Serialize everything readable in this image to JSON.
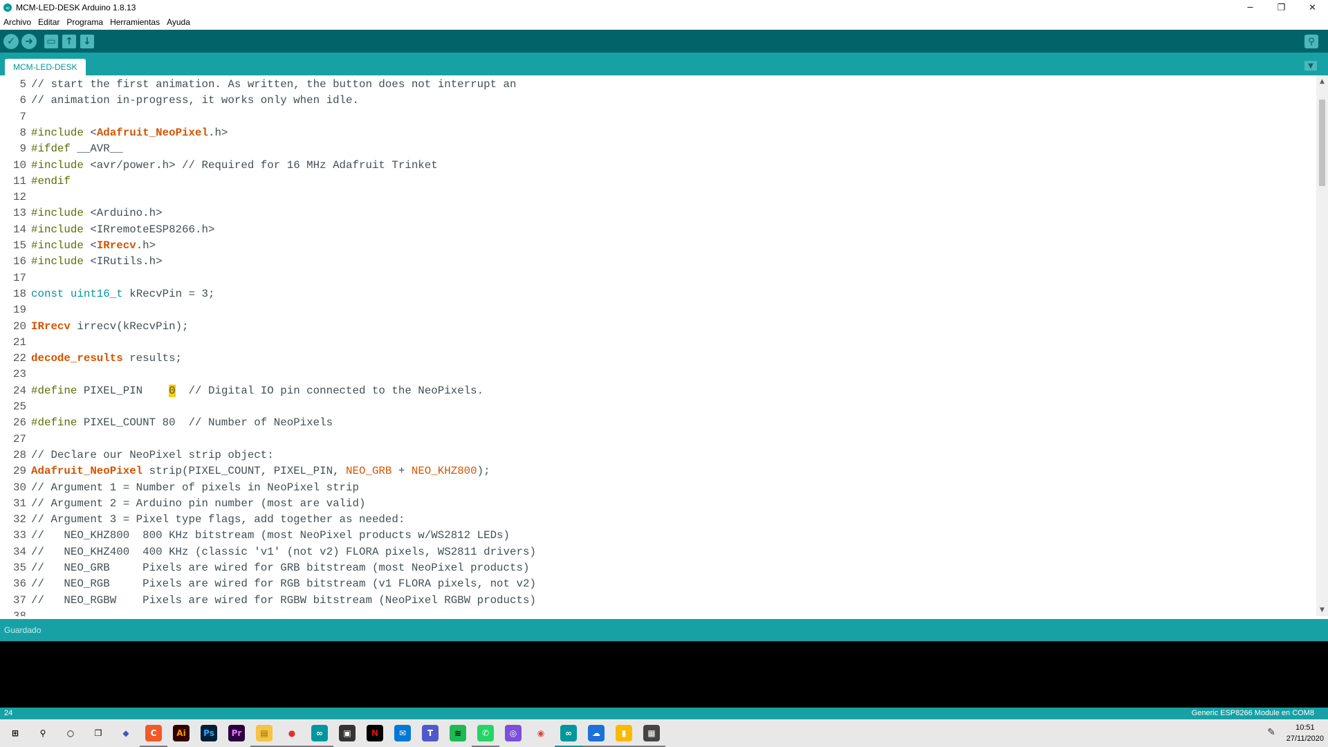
{
  "window": {
    "title": "MCM-LED-DESK Arduino 1.8.13",
    "minimize": "─",
    "restore": "❐",
    "close": "✕"
  },
  "menu": [
    "Archivo",
    "Editar",
    "Programa",
    "Herramientas",
    "Ayuda"
  ],
  "toolbar": {
    "verify_icon": "✓",
    "upload_icon": "➜",
    "new_icon": "▭",
    "open_icon": "↑",
    "save_icon": "↓",
    "serial_icon": "⚲"
  },
  "tabs": [
    {
      "label": "MCM-LED-DESK"
    }
  ],
  "tab_menu_icon": "▼",
  "code_lines": [
    {
      "n": "5",
      "parts": [
        [
          "cmt",
          "// start the first animation. As written, the button does not interrupt an"
        ]
      ]
    },
    {
      "n": "6",
      "parts": [
        [
          "cmt",
          "// animation in-progress, it works only when idle."
        ]
      ]
    },
    {
      "n": "7",
      "parts": []
    },
    {
      "n": "8",
      "parts": [
        [
          "kw",
          "#include"
        ],
        [
          "",
          " <"
        ],
        [
          "cls",
          "Adafruit_NeoPixel"
        ],
        [
          "",
          ".h>"
        ]
      ]
    },
    {
      "n": "9",
      "parts": [
        [
          "kw",
          "#ifdef"
        ],
        [
          "",
          " __AVR__"
        ]
      ]
    },
    {
      "n": "10",
      "parts": [
        [
          "kw",
          "#include"
        ],
        [
          "",
          " <avr/power.h> // Required for 16 MHz Adafruit Trinket"
        ]
      ]
    },
    {
      "n": "11",
      "parts": [
        [
          "kw",
          "#endif"
        ]
      ]
    },
    {
      "n": "12",
      "parts": []
    },
    {
      "n": "13",
      "parts": [
        [
          "kw",
          "#include"
        ],
        [
          "",
          " <Arduino.h>"
        ]
      ]
    },
    {
      "n": "14",
      "parts": [
        [
          "kw",
          "#include"
        ],
        [
          "",
          " <IRremoteESP8266.h>"
        ]
      ]
    },
    {
      "n": "15",
      "parts": [
        [
          "kw",
          "#include"
        ],
        [
          "",
          " <"
        ],
        [
          "cls",
          "IRrecv"
        ],
        [
          "",
          ".h>"
        ]
      ]
    },
    {
      "n": "16",
      "parts": [
        [
          "kw",
          "#include"
        ],
        [
          "",
          " <IRutils.h>"
        ]
      ]
    },
    {
      "n": "17",
      "parts": []
    },
    {
      "n": "18",
      "parts": [
        [
          "type",
          "const"
        ],
        [
          "",
          " "
        ],
        [
          "type",
          "uint16_t"
        ],
        [
          "",
          " kRecvPin = 3;"
        ]
      ]
    },
    {
      "n": "19",
      "parts": []
    },
    {
      "n": "20",
      "parts": [
        [
          "cls",
          "IRrecv"
        ],
        [
          "",
          " irrecv(kRecvPin);"
        ]
      ]
    },
    {
      "n": "21",
      "parts": []
    },
    {
      "n": "22",
      "parts": [
        [
          "cls",
          "decode_results"
        ],
        [
          "",
          " results;"
        ]
      ]
    },
    {
      "n": "23",
      "parts": []
    },
    {
      "n": "24",
      "parts": [
        [
          "kw",
          "#define"
        ],
        [
          "",
          " PIXEL_PIN    "
        ],
        [
          "hl",
          "0"
        ],
        [
          "",
          "  // Digital IO pin connected to the NeoPixels."
        ]
      ]
    },
    {
      "n": "25",
      "parts": []
    },
    {
      "n": "26",
      "parts": [
        [
          "kw",
          "#define"
        ],
        [
          "",
          " PIXEL_COUNT 80  // Number of NeoPixels"
        ]
      ]
    },
    {
      "n": "27",
      "parts": []
    },
    {
      "n": "28",
      "parts": [
        [
          "cmt",
          "// Declare our NeoPixel strip object:"
        ]
      ]
    },
    {
      "n": "29",
      "parts": [
        [
          "cls",
          "Adafruit_NeoPixel"
        ],
        [
          "",
          " strip(PIXEL_COUNT, PIXEL_PIN, "
        ],
        [
          "const",
          "NEO_GRB"
        ],
        [
          "",
          " + "
        ],
        [
          "const",
          "NEO_KHZ800"
        ],
        [
          "",
          ");"
        ]
      ]
    },
    {
      "n": "30",
      "parts": [
        [
          "cmt",
          "// Argument 1 = Number of pixels in NeoPixel strip"
        ]
      ]
    },
    {
      "n": "31",
      "parts": [
        [
          "cmt",
          "// Argument 2 = Arduino pin number (most are valid)"
        ]
      ]
    },
    {
      "n": "32",
      "parts": [
        [
          "cmt",
          "// Argument 3 = Pixel type flags, add together as needed:"
        ]
      ]
    },
    {
      "n": "33",
      "parts": [
        [
          "cmt",
          "//   NEO_KHZ800  800 KHz bitstream (most NeoPixel products w/WS2812 LEDs)"
        ]
      ]
    },
    {
      "n": "34",
      "parts": [
        [
          "cmt",
          "//   NEO_KHZ400  400 KHz (classic 'v1' (not v2) FLORA pixels, WS2811 drivers)"
        ]
      ]
    },
    {
      "n": "35",
      "parts": [
        [
          "cmt",
          "//   NEO_GRB     Pixels are wired for GRB bitstream (most NeoPixel products)"
        ]
      ]
    },
    {
      "n": "36",
      "parts": [
        [
          "cmt",
          "//   NEO_RGB     Pixels are wired for RGB bitstream (v1 FLORA pixels, not v2)"
        ]
      ]
    },
    {
      "n": "37",
      "parts": [
        [
          "cmt",
          "//   NEO_RGBW    Pixels are wired for RGBW bitstream (NeoPixel RGBW products)"
        ]
      ]
    },
    {
      "n": "38",
      "parts": []
    }
  ],
  "status": {
    "message": "Guardado"
  },
  "bottom": {
    "line": "24",
    "board": "Generic ESP8266 Module en COM8"
  },
  "taskbar": {
    "apps": [
      {
        "name": "start-icon",
        "glyph": "⊞",
        "color": "#e8e8e8",
        "fg": "#000"
      },
      {
        "name": "search-icon",
        "glyph": "⚲",
        "color": "#e8e8e8",
        "fg": "#000"
      },
      {
        "name": "cortana-icon",
        "glyph": "○",
        "color": "#e8e8e8",
        "fg": "#000"
      },
      {
        "name": "task-view-icon",
        "glyph": "❐",
        "color": "#e8e8e8",
        "fg": "#000"
      },
      {
        "name": "app-blue-icon",
        "glyph": "◆",
        "color": "#e8e8e8",
        "fg": "#3b5bb5"
      },
      {
        "name": "app-red-icon",
        "glyph": "C",
        "color": "#f05a28",
        "fg": "#fff"
      },
      {
        "name": "illustrator-icon",
        "glyph": "Ai",
        "color": "#330000",
        "fg": "#ff9a00"
      },
      {
        "name": "photoshop-icon",
        "glyph": "Ps",
        "color": "#001e36",
        "fg": "#31a8ff"
      },
      {
        "name": "premiere-icon",
        "glyph": "Pr",
        "color": "#2a003f",
        "fg": "#ea77ff"
      },
      {
        "name": "file-explorer-icon",
        "glyph": "▤",
        "color": "#f6c344",
        "fg": "#8a6d00"
      },
      {
        "name": "app-cube-icon",
        "glyph": "●",
        "color": "#e8e8e8",
        "fg": "#d33"
      },
      {
        "name": "arduino-icon",
        "glyph": "∞",
        "color": "#00979c",
        "fg": "#fff"
      },
      {
        "name": "store-icon",
        "glyph": "▣",
        "color": "#333",
        "fg": "#fff"
      },
      {
        "name": "netflix-icon",
        "glyph": "N",
        "color": "#000",
        "fg": "#e50914"
      },
      {
        "name": "mail-icon",
        "glyph": "✉",
        "color": "#0078d4",
        "fg": "#fff"
      },
      {
        "name": "teams-icon",
        "glyph": "T",
        "color": "#5059c9",
        "fg": "#fff"
      },
      {
        "name": "spotify-icon",
        "glyph": "≋",
        "color": "#1db954",
        "fg": "#000"
      },
      {
        "name": "whatsapp-icon",
        "glyph": "✆",
        "color": "#25d366",
        "fg": "#fff"
      },
      {
        "name": "app-purple-icon",
        "glyph": "◎",
        "color": "#7b4fd8",
        "fg": "#fff"
      },
      {
        "name": "chrome-icon",
        "glyph": "◉",
        "color": "#e8e8e8",
        "fg": "#db4437"
      },
      {
        "name": "arduino-running-icon",
        "glyph": "∞",
        "color": "#00979c",
        "fg": "#fff"
      },
      {
        "name": "app-cloud-icon",
        "glyph": "☁",
        "color": "#1e6fd9",
        "fg": "#fff"
      },
      {
        "name": "keep-icon",
        "glyph": "▮",
        "color": "#f9bb00",
        "fg": "#fff"
      },
      {
        "name": "calculator-icon",
        "glyph": "▦",
        "color": "#444",
        "fg": "#fff"
      }
    ],
    "pen_icon": "✎",
    "time": "10:51",
    "date": "27/11/2020"
  }
}
